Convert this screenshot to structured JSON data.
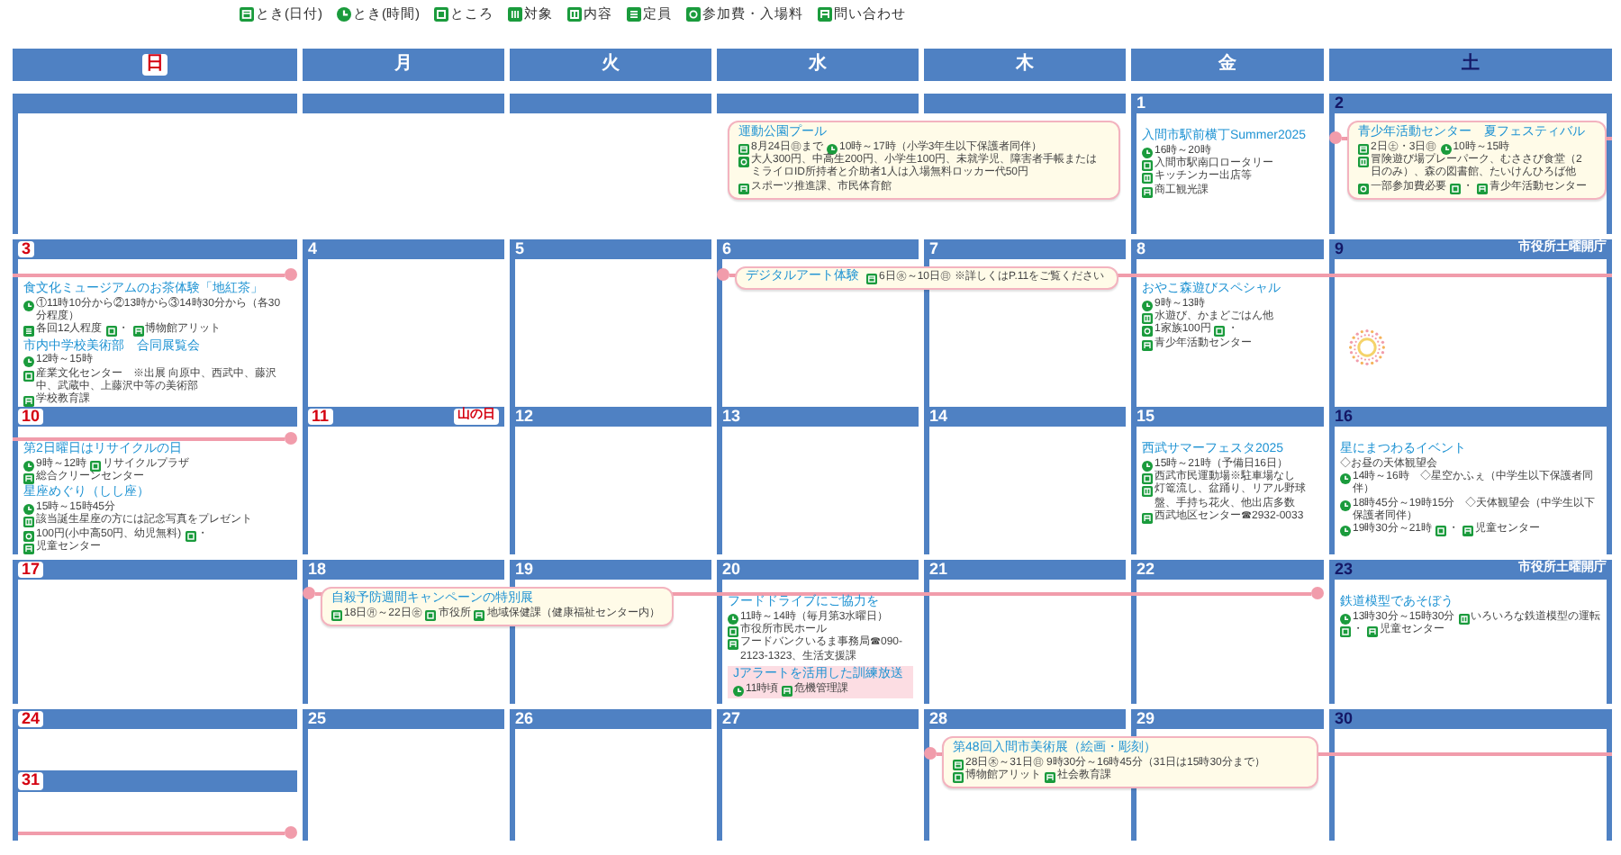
{
  "legend": [
    {
      "kind": "date",
      "label": "とき(日付)"
    },
    {
      "kind": "time",
      "label": "とき(時間)"
    },
    {
      "kind": "place",
      "label": "ところ"
    },
    {
      "kind": "target",
      "label": "対象"
    },
    {
      "kind": "content",
      "label": "内容"
    },
    {
      "kind": "capacity",
      "label": "定員"
    },
    {
      "kind": "fee",
      "label": "参加費・入場料"
    },
    {
      "kind": "contact",
      "label": "問い合わせ"
    }
  ],
  "weekdays": [
    {
      "label": "日",
      "kind": "sunday"
    },
    {
      "label": "月",
      "kind": "weekday"
    },
    {
      "label": "火",
      "kind": "weekday"
    },
    {
      "label": "水",
      "kind": "weekday"
    },
    {
      "label": "木",
      "kind": "weekday"
    },
    {
      "label": "金",
      "kind": "weekday"
    },
    {
      "label": "土",
      "kind": "saturday"
    }
  ],
  "weeks": [
    {
      "days": [
        {
          "kind": "blank"
        },
        {
          "kind": "blank"
        },
        {
          "kind": "blank"
        },
        {
          "kind": "blank",
          "spans_next_day": true,
          "events": [
            {
              "kind": "box",
              "title": "運動公園プール",
              "details": [
                {
                  "kind": "date",
                  "text": "8月24日㊐まで"
                },
                {
                  "kind": "time",
                  "text": "10時～17時（小学3年生以下保護者同伴）"
                },
                {
                  "kind": "fee",
                  "text": "大人300円、中高生200円、小学生100円、未就学児、障害者手帳またはミライロID所持者と介助者1人は入場無料ロッカー代50円"
                },
                {
                  "kind": "contact",
                  "text": "スポーツ推進課、市民体育館"
                }
              ]
            }
          ]
        },
        {
          "kind": "blank"
        },
        {
          "date": "1",
          "kind": "weekday",
          "events": [
            {
              "kind": "plain",
              "title": "入間市駅前横丁Summer2025",
              "details": [
                {
                  "kind": "time",
                  "text": "16時～20時"
                },
                {
                  "kind": "place",
                  "text": "入間市駅南口ロータリー"
                },
                {
                  "kind": "content",
                  "text": "キッチンカー出店等"
                },
                {
                  "kind": "contact",
                  "text": "商工観光課"
                }
              ]
            }
          ]
        },
        {
          "date": "2",
          "kind": "saturday",
          "bar_starts": true,
          "events": [
            {
              "kind": "box",
              "title": "青少年活動センター　夏フェスティバル",
              "details": [
                {
                  "kind": "date",
                  "text": "2日㊏・3日㊐"
                },
                {
                  "kind": "time",
                  "text": "10時～15時"
                },
                {
                  "kind": "content",
                  "text": "冒険遊び場プレーパーク、むささび食堂（2日のみ）、森の図書館、たいけんひろば他"
                },
                {
                  "kind": "fee",
                  "text": "一部参加費必要"
                },
                {
                  "kind": "place",
                  "text": "・"
                },
                {
                  "kind": "contact",
                  "text": "青少年活動センター"
                }
              ]
            }
          ]
        }
      ]
    },
    {
      "days": [
        {
          "date": "3",
          "kind": "sunday",
          "bar_ends": true,
          "events": [
            {
              "kind": "plain",
              "title": "食文化ミュージアムのお茶体験「地紅茶」",
              "details": [
                {
                  "kind": "time",
                  "text": "①11時10分から②13時から③14時30分から（各30分程度）"
                },
                {
                  "kind": "capacity",
                  "text": "各回12人程度"
                },
                {
                  "kind": "place",
                  "text": "・"
                },
                {
                  "kind": "contact",
                  "text": "博物館アリット"
                }
              ]
            },
            {
              "kind": "plain",
              "title": "市内中学校美術部　合同展覧会",
              "details": [
                {
                  "kind": "time",
                  "text": "12時～15時"
                },
                {
                  "kind": "place",
                  "text": "産業文化センター　※出展 向原中、西武中、藤沢中、武蔵中、上藤沢中等の美術部"
                },
                {
                  "kind": "contact",
                  "text": "学校教育課"
                }
              ]
            }
          ]
        },
        {
          "date": "4",
          "kind": "weekday"
        },
        {
          "date": "5",
          "kind": "weekday"
        },
        {
          "date": "6",
          "kind": "weekday",
          "bar_starts": true,
          "spans_next_day": true,
          "events": [
            {
              "kind": "banner",
              "title": "デジタルアート体験",
              "details": [
                {
                  "kind": "date",
                  "text": "6日㊌～10日㊐"
                },
                {
                  "kind": "note",
                  "text": "※詳しくはP.11をご覧ください"
                }
              ]
            }
          ]
        },
        {
          "date": "7",
          "kind": "weekday",
          "bar_continues": true
        },
        {
          "date": "8",
          "kind": "weekday",
          "bar_continues": true,
          "events": [
            {
              "kind": "plain",
              "title": "おやこ森遊びスペシャル",
              "details": [
                {
                  "kind": "time",
                  "text": "9時～13時"
                },
                {
                  "kind": "content",
                  "text": "水遊び、かまどごはん他"
                },
                {
                  "kind": "fee",
                  "text": "1家族100円"
                },
                {
                  "kind": "place",
                  "text": "・"
                },
                {
                  "kind": "contact",
                  "text": "青少年活動センター"
                }
              ]
            }
          ]
        },
        {
          "date": "9",
          "kind": "saturday",
          "note": "市役所土曜開庁",
          "bar_continues": true,
          "firework": true
        }
      ]
    },
    {
      "days": [
        {
          "date": "10",
          "kind": "sunday",
          "bar_ends": true,
          "events": [
            {
              "kind": "plain",
              "title": "第2日曜日はリサイクルの日",
              "details": [
                {
                  "kind": "time",
                  "text": "9時～12時"
                },
                {
                  "kind": "place",
                  "text": "リサイクルプラザ"
                },
                {
                  "kind": "contact",
                  "text": "総合クリーンセンター"
                }
              ]
            },
            {
              "kind": "plain",
              "title": "星座めぐり（しし座）",
              "details": [
                {
                  "kind": "time",
                  "text": "15時～15時45分"
                },
                {
                  "kind": "content",
                  "text": "該当誕生星座の方には記念写真をプレゼント"
                },
                {
                  "kind": "fee",
                  "text": "100円(小中高50円、幼児無料)"
                },
                {
                  "kind": "place",
                  "text": "・"
                },
                {
                  "kind": "contact",
                  "text": "児童センター"
                }
              ]
            }
          ]
        },
        {
          "date": "11",
          "kind": "holiday",
          "note": "山の日"
        },
        {
          "date": "12",
          "kind": "weekday"
        },
        {
          "date": "13",
          "kind": "weekday"
        },
        {
          "date": "14",
          "kind": "weekday"
        },
        {
          "date": "15",
          "kind": "weekday",
          "events": [
            {
              "kind": "plain",
              "title": "西武サマーフェスタ2025",
              "details": [
                {
                  "kind": "time",
                  "text": "15時～21時（予備日16日）"
                },
                {
                  "kind": "place",
                  "text": "西武市民運動場※駐車場なし"
                },
                {
                  "kind": "content",
                  "text": "灯篭流し、盆踊り、リアル野球盤、手持ち花火、他出店多数"
                },
                {
                  "kind": "contact",
                  "text": "西武地区センター☎2932-0033"
                }
              ]
            }
          ]
        },
        {
          "date": "16",
          "kind": "saturday",
          "events": [
            {
              "kind": "plain",
              "title": "星にまつわるイベント",
              "details": [
                {
                  "kind": "note",
                  "text": "◇お昼の天体観望会"
                },
                {
                  "kind": "time",
                  "text": "14時～16時　◇星空かふぇ（中学生以下保護者同伴）"
                },
                {
                  "kind": "time",
                  "text": "18時45分～19時15分　◇天体観望会（中学生以下保護者同伴）"
                },
                {
                  "kind": "time",
                  "text": "19時30分～21時"
                },
                {
                  "kind": "place",
                  "text": "・"
                },
                {
                  "kind": "contact",
                  "text": "児童センター"
                }
              ]
            }
          ]
        }
      ]
    },
    {
      "days": [
        {
          "date": "17",
          "kind": "sunday"
        },
        {
          "date": "18",
          "kind": "weekday",
          "bar_starts": true,
          "spans_next_day": true,
          "events": [
            {
              "kind": "box",
              "title": "自殺予防週間キャンペーンの特別展",
              "details": [
                {
                  "kind": "date",
                  "text": "18日㊊～22日㊎"
                },
                {
                  "kind": "place",
                  "text": "市役所"
                },
                {
                  "kind": "contact",
                  "text": "地域保健課（健康福祉センター内）"
                }
              ]
            }
          ]
        },
        {
          "date": "19",
          "kind": "weekday",
          "bar_continues": true
        },
        {
          "date": "20",
          "kind": "weekday",
          "bar_continues": true,
          "events": [
            {
              "kind": "plain",
              "title": "フードドライブにご協力を",
              "details": [
                {
                  "kind": "time",
                  "text": "11時～14時（毎月第3水曜日）"
                },
                {
                  "kind": "place",
                  "text": "市役所市民ホール"
                },
                {
                  "kind": "contact",
                  "text": "フードバンクいるま事務局☎090-2123-1323、生活支援課"
                }
              ]
            },
            {
              "kind": "alert",
              "title": "Jアラートを活用した訓練放送",
              "details": [
                {
                  "kind": "time",
                  "text": "11時頃"
                },
                {
                  "kind": "contact",
                  "text": "危機管理課"
                }
              ]
            }
          ]
        },
        {
          "date": "21",
          "kind": "weekday",
          "bar_continues": true
        },
        {
          "date": "22",
          "kind": "weekday",
          "bar_ends": true
        },
        {
          "date": "23",
          "kind": "saturday",
          "note": "市役所土曜開庁",
          "events": [
            {
              "kind": "plain",
              "title": "鉄道模型であそぼう",
              "details": [
                {
                  "kind": "time",
                  "text": "13時30分～15時30分"
                },
                {
                  "kind": "content",
                  "text": "いろいろな鉄道模型の運転"
                },
                {
                  "kind": "place",
                  "text": "・"
                },
                {
                  "kind": "contact",
                  "text": "児童センター"
                }
              ]
            }
          ]
        }
      ]
    },
    {
      "days": [
        {
          "date": "24",
          "kind": "sunday",
          "below": {
            "date": "31",
            "kind": "sunday",
            "bar_ends": true
          }
        },
        {
          "date": "25",
          "kind": "weekday"
        },
        {
          "date": "26",
          "kind": "weekday"
        },
        {
          "date": "27",
          "kind": "weekday"
        },
        {
          "date": "28",
          "kind": "weekday",
          "bar_starts": true,
          "spans_next_day": true,
          "events": [
            {
              "kind": "box",
              "title": "第48回入間市美術展（絵画・彫刻）",
              "details": [
                {
                  "kind": "date",
                  "text": "28日㊍～31日㊐ 9時30分～16時45分（31日は15時30分まで）"
                },
                {
                  "kind": "place",
                  "text": "博物館アリット"
                },
                {
                  "kind": "contact",
                  "text": "社会教育課"
                }
              ]
            }
          ]
        },
        {
          "date": "29",
          "kind": "weekday",
          "bar_continues": true
        },
        {
          "date": "30",
          "kind": "saturday",
          "bar_continues": true
        }
      ]
    }
  ]
}
